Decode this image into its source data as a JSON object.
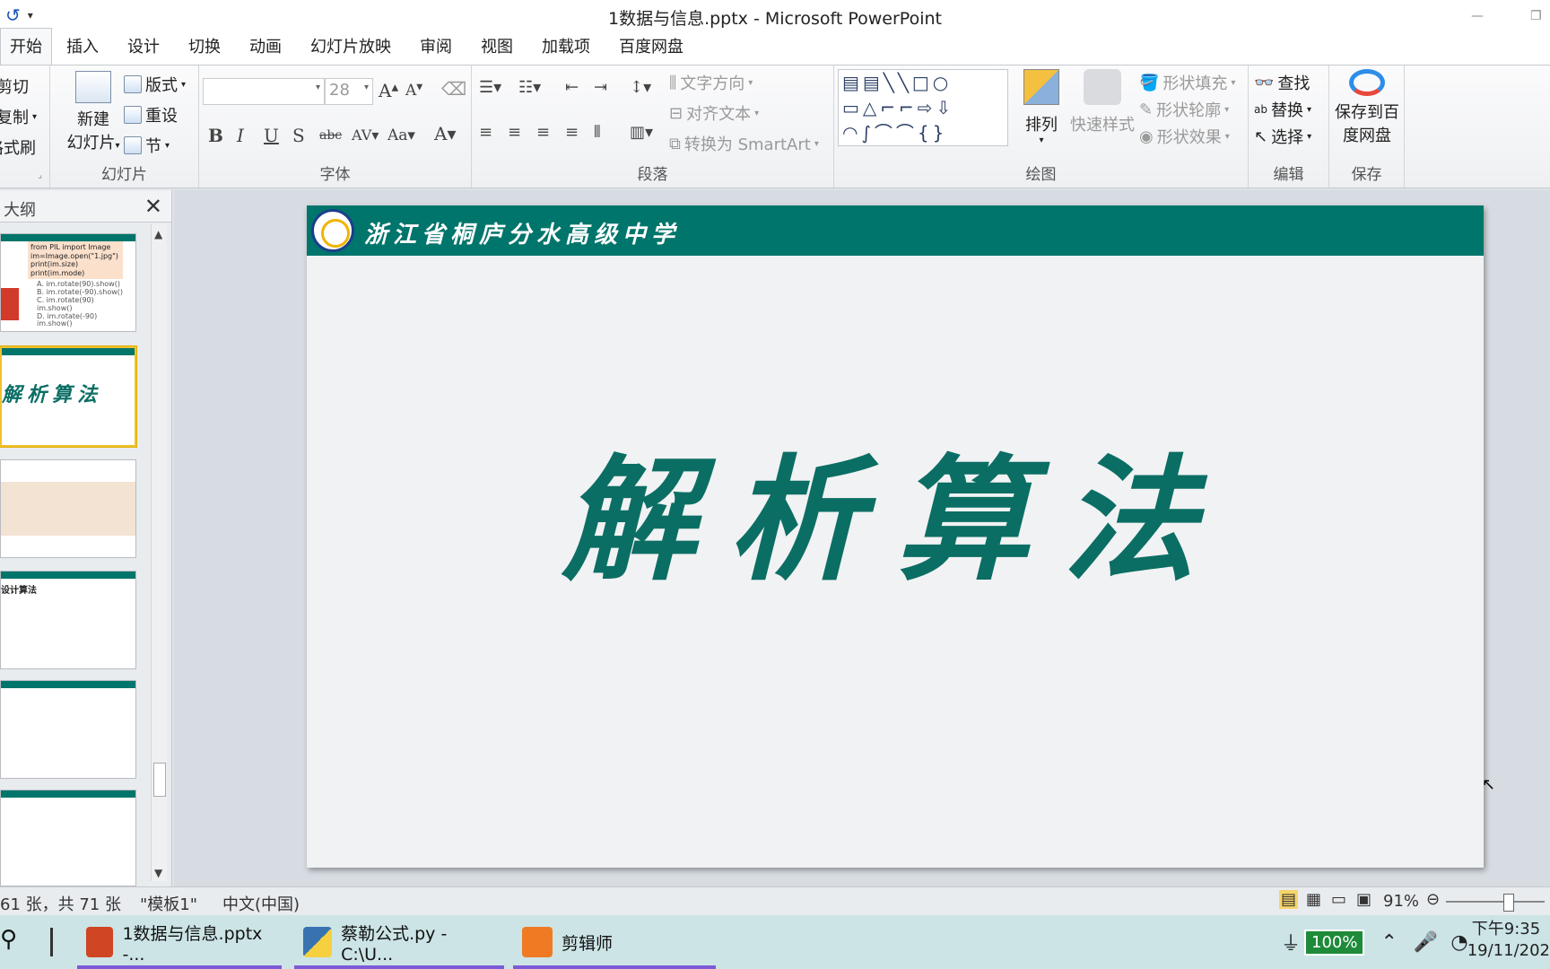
{
  "window": {
    "title": "1数据与信息.pptx - Microsoft PowerPoint"
  },
  "tabs": [
    "开始",
    "插入",
    "设计",
    "切换",
    "动画",
    "幻灯片放映",
    "审阅",
    "视图",
    "加载项",
    "百度网盘"
  ],
  "ribbon": {
    "clipboard": {
      "cut": "剪切",
      "copy": "复制",
      "format_painter": "格式刷"
    },
    "slides": {
      "new_slide_line1": "新建",
      "new_slide_line2": "幻灯片",
      "layout": "版式",
      "reset": "重设",
      "section": "节",
      "label": "幻灯片"
    },
    "font": {
      "size": "28",
      "label": "字体"
    },
    "paragraph": {
      "text_direction": "文字方向",
      "align_text": "对齐文本",
      "convert_smartart": "转换为 SmartArt",
      "label": "段落"
    },
    "drawing": {
      "arrange": "排列",
      "quick_styles": "快速样式",
      "shape_fill": "形状填充",
      "shape_outline": "形状轮廓",
      "shape_effects": "形状效果",
      "label": "绘图"
    },
    "editing": {
      "find": "查找",
      "replace": "替换",
      "select": "选择",
      "label": "编辑"
    },
    "save": {
      "save_to_baidu_line1": "保存到百",
      "save_to_baidu_line2": "度网盘",
      "label": "保存"
    }
  },
  "sidepane": {
    "header": "大纲",
    "thumbs": [
      {
        "lines": [
          "from PIL import Image",
          "im=Image.open(\"1.jpg\")",
          "print(im.size)",
          "print(im.mode)",
          "A. im.rotate(90).show()",
          "B. im.rotate(-90).show()",
          "C. im.rotate(90)",
          "   im.show()",
          "D. im.rotate(-90)",
          "   im.show()"
        ]
      },
      {
        "title": "解析算法"
      },
      {
        "lines": [
          "...",
          "..."
        ]
      },
      {
        "title": "设计算法"
      },
      {
        "lines": []
      },
      {
        "lines": []
      }
    ]
  },
  "slide": {
    "school": "浙江省桐庐分水高级中学",
    "title": "解析算法"
  },
  "status": {
    "slide_info": "61 张，共 71 张",
    "theme": "\"模板1\"",
    "lang": "中文(中国)",
    "zoom": "91%"
  },
  "taskbar": {
    "item1": "1数据与信息.pptx -...",
    "item2": "蔡勒公式.py - C:\\U...",
    "item3": "剪辑师",
    "battery": "100%",
    "time": "下午9:35",
    "date": "19/11/202"
  },
  "colors": {
    "accent": "#00756b",
    "title_text": "#0b6e64"
  }
}
